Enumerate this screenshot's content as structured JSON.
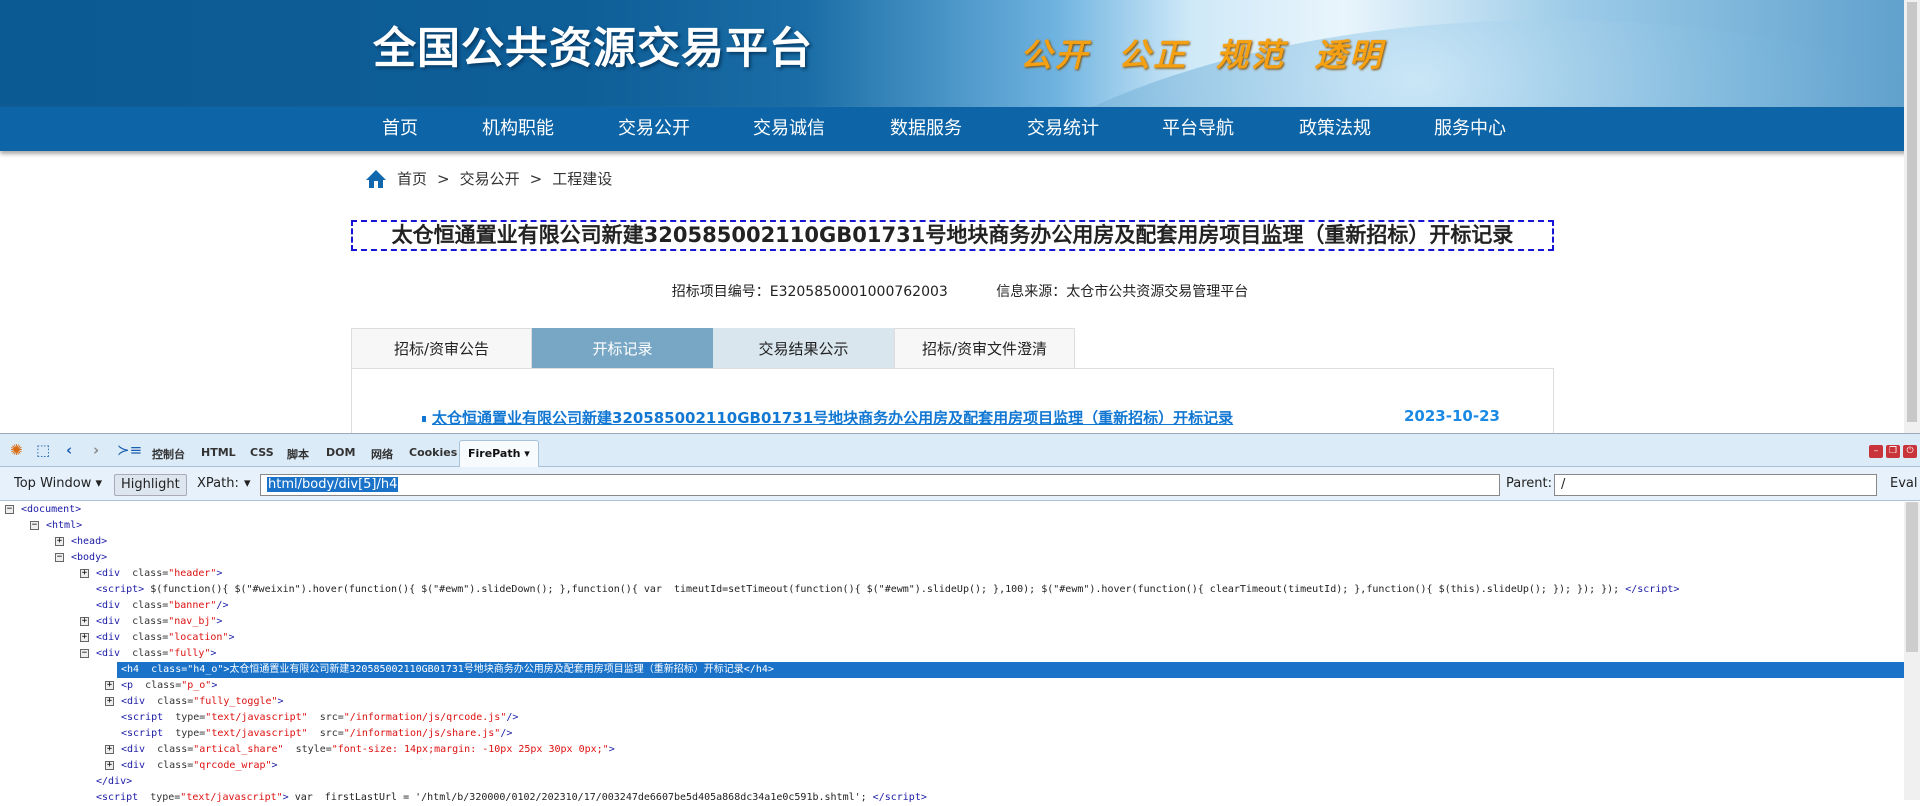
{
  "header": {
    "site_title": "全国公共资源交易平台",
    "slogan": "公开 公正 规范 透明"
  },
  "nav": [
    "首页",
    "机构职能",
    "交易公开",
    "交易诚信",
    "数据服务",
    "交易统计",
    "平台导航",
    "政策法规",
    "服务中心"
  ],
  "breadcrumb": {
    "icon": "home-icon",
    "items": [
      "首页",
      "交易公开",
      "工程建设"
    ],
    "separator": ">"
  },
  "article": {
    "title": "太仓恒通置业有限公司新建320585002110GB01731号地块商务办公用房及配套用房项目监理（重新招标）开标记录",
    "project_no": "招标项目编号：E3205850001000762003",
    "source": "信息来源：太仓市公共资源交易管理平台"
  },
  "tabs": [
    {
      "label": "招标/资审公告",
      "state": "normal"
    },
    {
      "label": "开标记录",
      "state": "active"
    },
    {
      "label": "交易结果公示",
      "state": "light"
    },
    {
      "label": "招标/资审文件澄清",
      "state": "normal"
    }
  ],
  "list": [
    {
      "title": "太仓恒通置业有限公司新建320585002110GB01731号地块商务办公用房及配套用房项目监理（重新招标）开标记录",
      "date": "2023-10-23"
    }
  ],
  "devtools": {
    "tabs": [
      "控制台",
      "HTML",
      "CSS",
      "脚本",
      "DOM",
      "网络",
      "Cookies",
      "FirePath ▾"
    ],
    "active_tab": "FirePath ▾",
    "top_window": "Top Window ▾",
    "highlight": "Highlight",
    "xpath_label": "XPath:",
    "xpath_dropdown": "▾",
    "xpath_value": "html/body/div[5]/h4",
    "parent_label": "Parent:",
    "parent_value": "/",
    "eval": "Eval",
    "tree": [
      {
        "lvl": 0,
        "tg": "-",
        "p": [
          [
            "tag",
            "<document>"
          ]
        ]
      },
      {
        "lvl": 1,
        "tg": "-",
        "p": [
          [
            "tag",
            "<html>"
          ]
        ]
      },
      {
        "lvl": 2,
        "tg": "+",
        "p": [
          [
            "tag",
            "<head>"
          ]
        ]
      },
      {
        "lvl": 2,
        "tg": "-",
        "p": [
          [
            "tag",
            "<body>"
          ]
        ]
      },
      {
        "lvl": 3,
        "tg": "+",
        "p": [
          [
            "tag",
            "<div  "
          ],
          [
            "attr",
            "class="
          ],
          [
            "val",
            "\"header\""
          ],
          [
            "tag",
            ">"
          ]
        ]
      },
      {
        "lvl": 3,
        "tg": "",
        "p": [
          [
            "tag",
            "<script> "
          ],
          [
            "text",
            "$(function(){ $(\"#weixin\").hover(function(){ $(\"#ewm\").slideDown(); },function(){ var  timeutId=setTimeout(function(){ $(\"#ewm\").slideUp(); },100); $(\"#ewm\").hover(function(){ clearTimeout(timeutId); },function(){ $(this).slideUp(); }); }); }); "
          ],
          [
            "tag",
            "</script>"
          ]
        ]
      },
      {
        "lvl": 3,
        "tg": "",
        "p": [
          [
            "tag",
            "<div  "
          ],
          [
            "attr",
            "class="
          ],
          [
            "val",
            "\"banner\""
          ],
          [
            "tag",
            "/>"
          ]
        ]
      },
      {
        "lvl": 3,
        "tg": "+",
        "p": [
          [
            "tag",
            "<div  "
          ],
          [
            "attr",
            "class="
          ],
          [
            "val",
            "\"nav_bj\""
          ],
          [
            "tag",
            ">"
          ]
        ]
      },
      {
        "lvl": 3,
        "tg": "+",
        "p": [
          [
            "tag",
            "<div  "
          ],
          [
            "attr",
            "class="
          ],
          [
            "val",
            "\"location\""
          ],
          [
            "tag",
            ">"
          ]
        ]
      },
      {
        "lvl": 3,
        "tg": "-",
        "p": [
          [
            "tag",
            "<div  "
          ],
          [
            "attr",
            "class="
          ],
          [
            "val",
            "\"fully\""
          ],
          [
            "tag",
            ">"
          ]
        ]
      },
      {
        "lvl": 4,
        "tg": "",
        "sel": true,
        "p": [
          [
            "tag",
            "<h4  "
          ],
          [
            "attr",
            "class="
          ],
          [
            "val",
            "\"h4_o\""
          ],
          [
            "tag",
            ">"
          ],
          [
            "text",
            "太仓恒通置业有限公司新建320585002110GB01731号地块商务办公用房及配套用房项目监理（重新招标）开标记录"
          ],
          [
            "tag",
            "</h4>"
          ]
        ]
      },
      {
        "lvl": 4,
        "tg": "+",
        "p": [
          [
            "tag",
            "<p  "
          ],
          [
            "attr",
            "class="
          ],
          [
            "val",
            "\"p_o\""
          ],
          [
            "tag",
            ">"
          ]
        ]
      },
      {
        "lvl": 4,
        "tg": "+",
        "p": [
          [
            "tag",
            "<div  "
          ],
          [
            "attr",
            "class="
          ],
          [
            "val",
            "\"fully_toggle\""
          ],
          [
            "tag",
            ">"
          ]
        ]
      },
      {
        "lvl": 4,
        "tg": "",
        "p": [
          [
            "tag",
            "<script  "
          ],
          [
            "attr",
            "type="
          ],
          [
            "val",
            "\"text/javascript\"  "
          ],
          [
            "attr",
            "src="
          ],
          [
            "val",
            "\"/information/js/qrcode.js\""
          ],
          [
            "tag",
            "/>"
          ]
        ]
      },
      {
        "lvl": 4,
        "tg": "",
        "p": [
          [
            "tag",
            "<script  "
          ],
          [
            "attr",
            "type="
          ],
          [
            "val",
            "\"text/javascript\"  "
          ],
          [
            "attr",
            "src="
          ],
          [
            "val",
            "\"/information/js/share.js\""
          ],
          [
            "tag",
            "/>"
          ]
        ]
      },
      {
        "lvl": 4,
        "tg": "+",
        "p": [
          [
            "tag",
            "<div  "
          ],
          [
            "attr",
            "class="
          ],
          [
            "val",
            "\"artical_share\"  "
          ],
          [
            "attr",
            "style="
          ],
          [
            "val",
            "\"font-size: 14px;margin: -10px 25px 30px 0px;\""
          ],
          [
            "tag",
            ">"
          ]
        ]
      },
      {
        "lvl": 4,
        "tg": "+",
        "p": [
          [
            "tag",
            "<div  "
          ],
          [
            "attr",
            "class="
          ],
          [
            "val",
            "\"qrcode_wrap\""
          ],
          [
            "tag",
            ">"
          ]
        ]
      },
      {
        "lvl": 3,
        "tg": "",
        "p": [
          [
            "tag",
            "</div>"
          ]
        ]
      },
      {
        "lvl": 3,
        "tg": "",
        "p": [
          [
            "tag",
            "<script  "
          ],
          [
            "attr",
            "type="
          ],
          [
            "val",
            "\"text/javascript\""
          ],
          [
            "tag",
            "> "
          ],
          [
            "text",
            "var  firstLastUrl = '/html/b/320000/0102/202310/17/003247de6607be5d405a868dc34a1e0c591b.shtml'; "
          ],
          [
            "tag",
            "</script>"
          ]
        ]
      }
    ]
  },
  "colors": {
    "nav_bg": "#0d64a6",
    "tab_active": "#78a7c6",
    "link": "#1177d2",
    "selection": "#1a73c9",
    "slogan": "#f4a012"
  }
}
